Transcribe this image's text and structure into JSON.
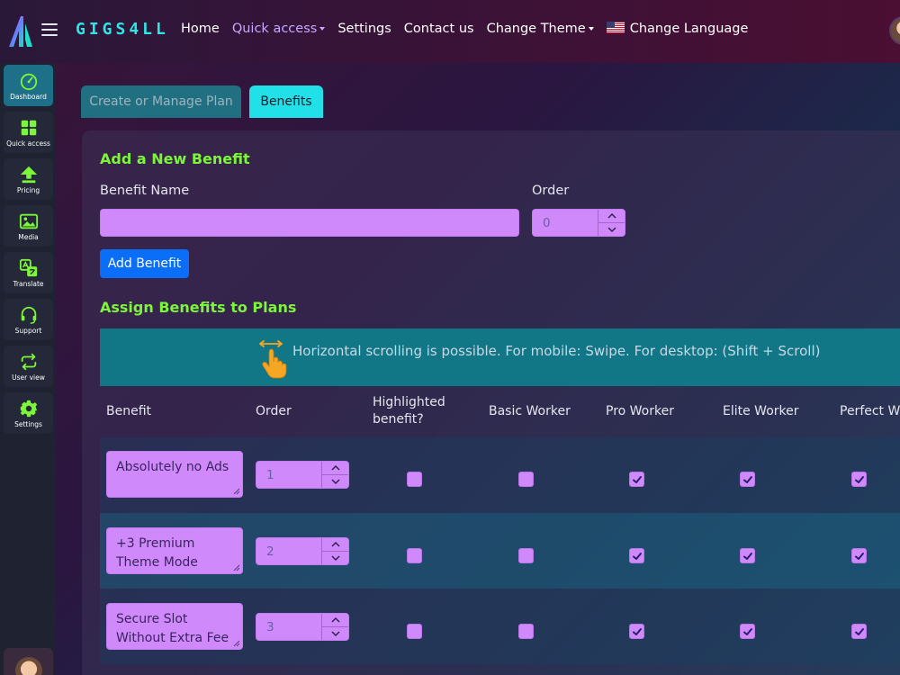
{
  "brand": "GIGS4LL",
  "nav": {
    "home": "Home",
    "quick_access": "Quick access",
    "settings": "Settings",
    "contact": "Contact us",
    "theme": "Change Theme",
    "language": "Change Language"
  },
  "sidebar": {
    "items": [
      {
        "label": "Dashboard",
        "icon": "gauge-icon"
      },
      {
        "label": "Quick access",
        "icon": "grid-icon"
      },
      {
        "label": "Pricing",
        "icon": "upload-arrow-icon"
      },
      {
        "label": "Media",
        "icon": "image-icon"
      },
      {
        "label": "Translate",
        "icon": "translate-icon"
      },
      {
        "label": "Support",
        "icon": "headset-icon"
      },
      {
        "label": "User view",
        "icon": "repeat-icon"
      },
      {
        "label": "Settings",
        "icon": "gear-icon"
      }
    ]
  },
  "tabs": {
    "plan": "Create or Manage Plan",
    "benefits": "Benefits"
  },
  "add_section": {
    "title": "Add a New Benefit",
    "name_label": "Benefit Name",
    "name_value": "",
    "order_label": "Order",
    "order_value": "0",
    "add_button": "Add Benefit"
  },
  "assign_section": {
    "title": "Assign Benefits to Plans",
    "scroll_hint": "Horizontal scrolling is possible. For mobile: Swipe. For desktop: (Shift + Scroll)"
  },
  "table": {
    "headers": {
      "benefit": "Benefit",
      "order": "Order",
      "highlighted_1": "Highlighted",
      "highlighted_2": "benefit?",
      "basic": "Basic Worker",
      "pro": "Pro Worker",
      "elite": "Elite Worker",
      "perfect": "Perfect Wo"
    },
    "rows": [
      {
        "benefit": "Absolutely no Ads",
        "order": "1",
        "highlighted": false,
        "basic": false,
        "pro": true,
        "elite": true,
        "perfect": true
      },
      {
        "benefit": "+3 Premium Theme Mode",
        "order": "2",
        "highlighted": false,
        "basic": false,
        "pro": true,
        "elite": true,
        "perfect": true
      },
      {
        "benefit": "Secure Slot Without Extra Fee",
        "order": "3",
        "highlighted": false,
        "basic": false,
        "pro": true,
        "elite": true,
        "perfect": true
      }
    ]
  },
  "colors": {
    "accent_green": "#7cf53a",
    "brand_cyan": "#2ee6e6",
    "input_purple": "#d089fb",
    "button_blue": "#0b6ef9",
    "banner_teal": "#117787"
  }
}
